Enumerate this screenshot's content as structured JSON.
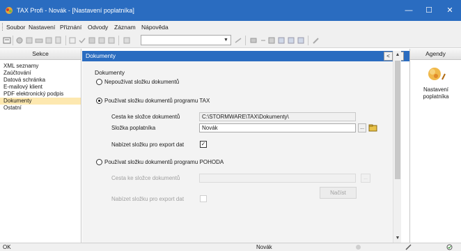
{
  "window": {
    "title": "TAX Profi - Novák - [Nastavení poplatníka]",
    "controls": {
      "minimize": "—",
      "maximize": "☐",
      "close": "✕"
    }
  },
  "menu": {
    "items": [
      {
        "label": "Soubor"
      },
      {
        "label": "Nastavení"
      },
      {
        "label": "Přiznání"
      },
      {
        "label": "Odvody"
      },
      {
        "label": "Záznam"
      },
      {
        "label": "Nápověda"
      }
    ]
  },
  "toolbar": {
    "combo_value": "",
    "combo_arrow": "▼",
    "icons": [
      "properties-icon",
      "settings-icon",
      "print-preview-icon",
      "print-icon",
      "export-icon",
      "copy-icon",
      "check-icon",
      "save-icon",
      "save-all-icon",
      "calc-icon",
      "close-doc-icon",
      "filter-icon",
      "folder-icon",
      "list-icon",
      "table-icon",
      "grid-icon",
      "columns-icon",
      "form-icon",
      "edit-icon"
    ]
  },
  "sections": {
    "header": "Sekce",
    "items": [
      {
        "label": "XML seznamy",
        "selected": false
      },
      {
        "label": "Zaúčtování",
        "selected": false
      },
      {
        "label": "Datová schránka",
        "selected": false
      },
      {
        "label": "E-mailový klient",
        "selected": false
      },
      {
        "label": "PDF elektronický podpis",
        "selected": false
      },
      {
        "label": "Dokumenty",
        "selected": true
      },
      {
        "label": "Ostatní",
        "selected": false
      }
    ]
  },
  "main": {
    "header": "Dokumenty",
    "nav_prev": "<",
    "nav_next": ">",
    "group_title": "Dokumenty",
    "options": {
      "none_label": "Nepoužívat složku dokumentů",
      "tax_label": "Používat složku dokumentů programu TAX",
      "pohoda_label": "Používat složku dokumentů programu POHODA",
      "selected": "tax"
    },
    "tax": {
      "path_label": "Cesta ke složce dokumentů",
      "path_value": "C:\\STORMWARE\\TAX\\Dokumenty\\",
      "folder_label": "Složka poplatníka",
      "folder_value": "Novák",
      "browse_btn": "...",
      "export_label": "Nabízet složku pro export dat",
      "export_checked": true,
      "check_mark": "✓"
    },
    "pohoda": {
      "path_label": "Cesta ke složce dokumentů",
      "path_value": "",
      "browse_btn": "...",
      "load_button": "Načíst",
      "export_label": "Nabízet složku pro export dat",
      "export_checked": false
    }
  },
  "scrollbar": {
    "up": "▲",
    "down": "▼"
  },
  "agendas": {
    "header": "Agendy",
    "items": [
      {
        "label_line1": "Nastavení",
        "label_line2": "poplatníka",
        "icon": "taxpayer-settings-icon"
      }
    ]
  },
  "status": {
    "left": "OK",
    "user": "Novák"
  },
  "colors": {
    "titlebar": "#2a6cc0",
    "selection": "#fde8b0",
    "panel": "#f3f3f3"
  }
}
